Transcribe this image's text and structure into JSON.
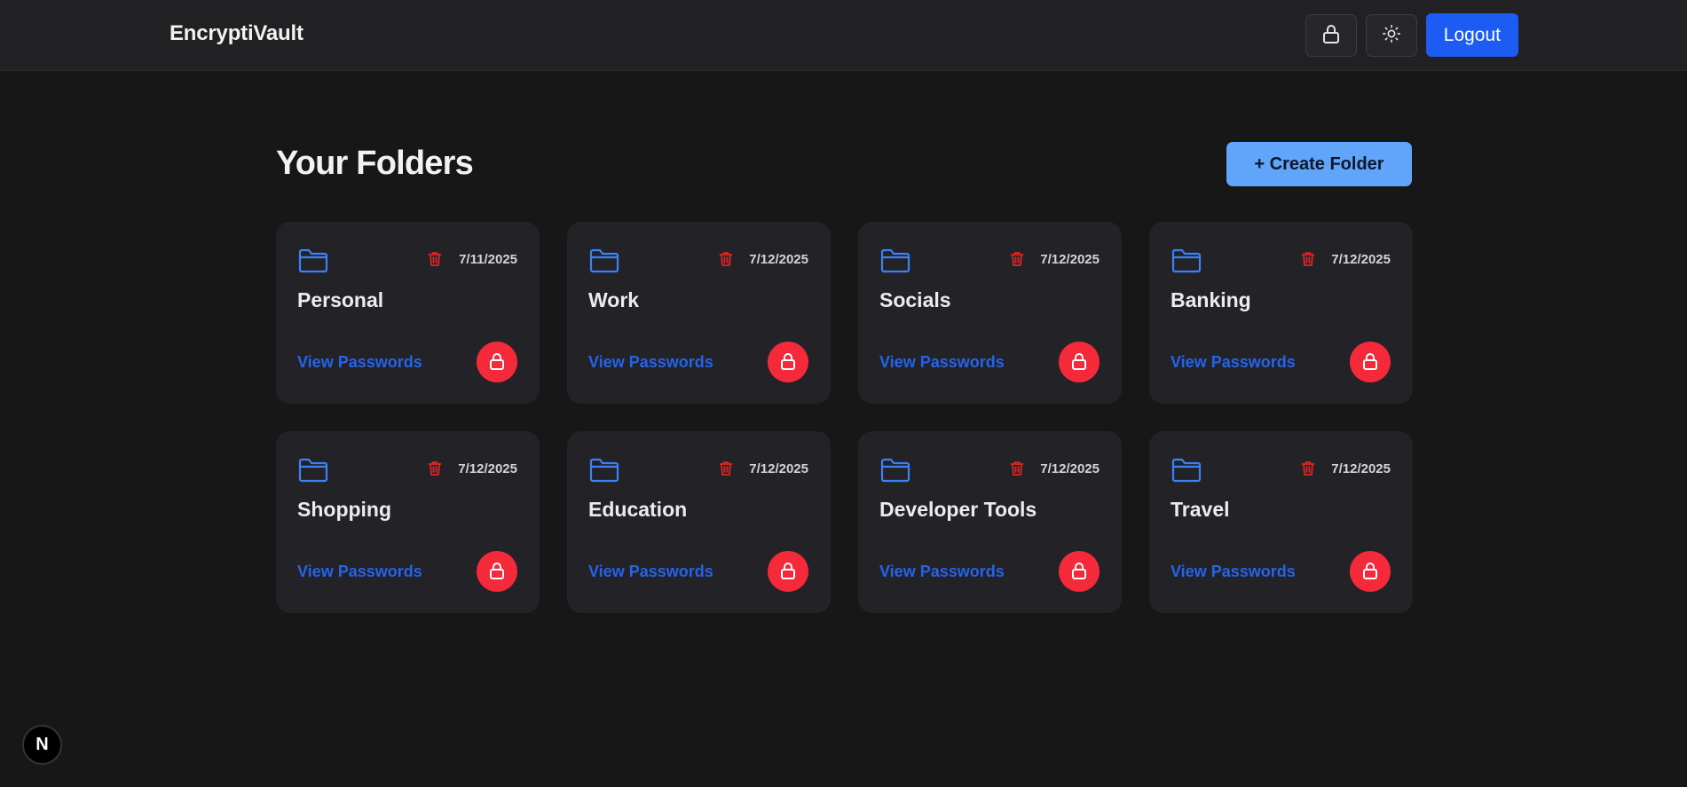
{
  "header": {
    "brand": "EncryptiVault",
    "lock_icon": "lock-icon",
    "theme_icon": "sun-icon",
    "logout_label": "Logout"
  },
  "main": {
    "title": "Your Folders",
    "create_label": "+ Create Folder"
  },
  "folders": [
    {
      "name": "Personal",
      "date": "7/11/2025",
      "link": "View Passwords"
    },
    {
      "name": "Work",
      "date": "7/12/2025",
      "link": "View Passwords"
    },
    {
      "name": "Socials",
      "date": "7/12/2025",
      "link": "View Passwords"
    },
    {
      "name": "Banking",
      "date": "7/12/2025",
      "link": "View Passwords"
    },
    {
      "name": "Shopping",
      "date": "7/12/2025",
      "link": "View Passwords"
    },
    {
      "name": "Education",
      "date": "7/12/2025",
      "link": "View Passwords"
    },
    {
      "name": "Developer Tools",
      "date": "7/12/2025",
      "link": "View Passwords"
    },
    {
      "name": "Travel",
      "date": "7/12/2025",
      "link": "View Passwords"
    }
  ],
  "dev_badge": {
    "label": "N"
  },
  "colors": {
    "background": "#171717",
    "navbar": "#212124",
    "card": "#232327",
    "accent_blue": "#1c5cf5",
    "create_button": "#60a5fa",
    "link_blue": "#2563eb",
    "danger_red": "#f42a3a",
    "trash_red": "#dc2626"
  }
}
